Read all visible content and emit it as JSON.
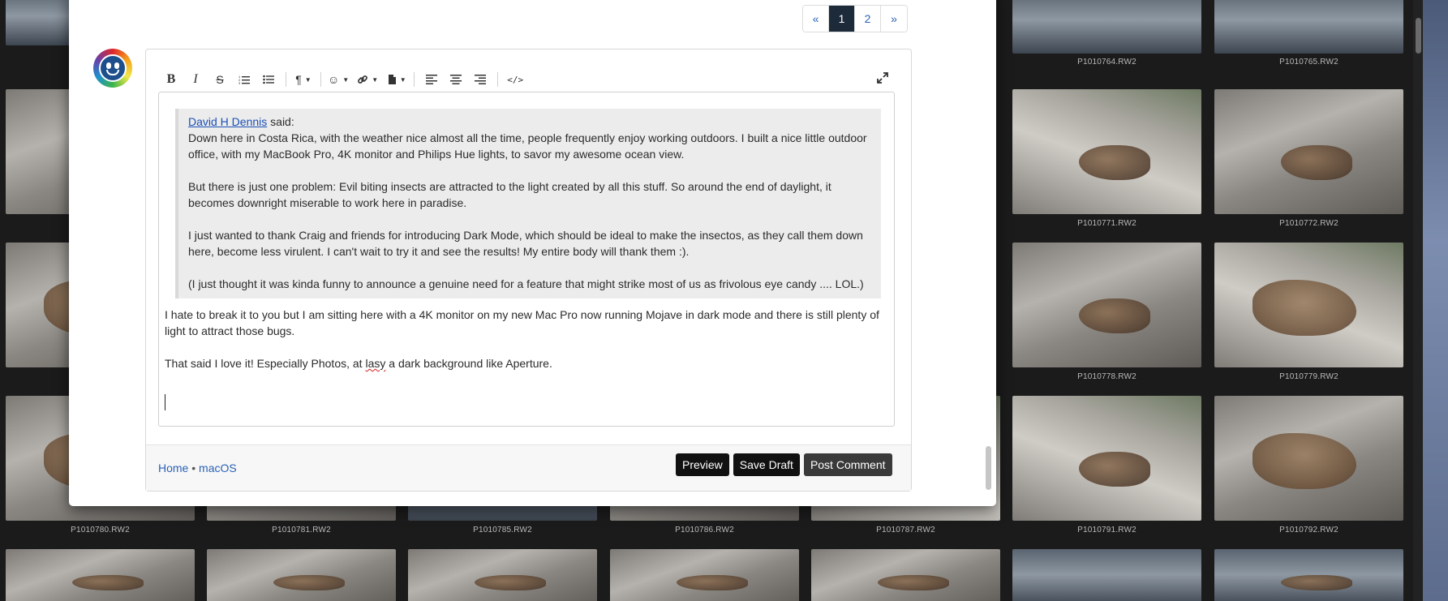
{
  "gallery": {
    "row1": [
      {
        "file": "P1010764.RW2"
      },
      {
        "file": "P1010765.RW2"
      }
    ],
    "row2": [
      {
        "file": "P1010771.RW2"
      },
      {
        "file": "P1010772.RW2"
      }
    ],
    "row3": [
      {
        "file": "P1010778.RW2"
      },
      {
        "file": "P1010779.RW2"
      }
    ],
    "row4": [
      {
        "file": "P1010780.RW2"
      },
      {
        "file": "P1010781.RW2"
      },
      {
        "file": "P1010785.RW2"
      },
      {
        "file": "P1010786.RW2"
      },
      {
        "file": "P1010787.RW2"
      },
      {
        "file": "P1010791.RW2"
      },
      {
        "file": "P1010792.RW2"
      }
    ]
  },
  "pagination": {
    "prev": "«",
    "pages": [
      "1",
      "2"
    ],
    "next": "»",
    "current": "1"
  },
  "toolbar": {
    "bold": "B",
    "italic": "I",
    "strike": "S",
    "ordered_list": "⒈",
    "bullet_list": "☰",
    "paragraph": "¶",
    "emoji": "☺",
    "link": "🔗",
    "file": "▮",
    "align_left": "≡",
    "align_center": "≡",
    "align_right": "≡",
    "code": "</>",
    "fullscreen": "⤢"
  },
  "quote": {
    "author": "David H Dennis",
    "said": " said:",
    "paragraphs": [
      "Down here in Costa Rica, with the weather nice almost all the time, people frequently enjoy working outdoors.  I built a nice little outdoor office, with my MacBook Pro, 4K monitor and Philips Hue lights, to savor my awesome ocean view.",
      "But there is just one problem: Evil biting insects are attracted to the light created by all this stuff.  So around the end of daylight, it becomes downright miserable to work here in paradise.",
      "I just wanted to thank Craig and friends for introducing Dark Mode, which should be ideal to make the insectos, as they call them down here, become less virulent.  I can't wait to try it and see the results!  My entire body will thank them :).",
      "(I just thought it was kinda funny to announce a genuine need for a feature that might strike most of us as frivolous eye candy .... LOL.)"
    ]
  },
  "reply": {
    "paragraph1": "I hate to break it to you but I am sitting here with a 4K monitor on my new Mac Pro now running Mojave in dark mode and there is still plenty of light to attract those bugs.",
    "p2_before": "That said I love it!  Especially Photos, at ",
    "p2_misspelled": "lasy",
    "p2_after": " a dark background like Aperture."
  },
  "footer": {
    "home": "Home",
    "separator": " • ",
    "category": "macOS",
    "preview": "Preview",
    "save_draft": "Save Draft",
    "post_comment": "Post Comment"
  },
  "scroll_top_icon": "︿"
}
